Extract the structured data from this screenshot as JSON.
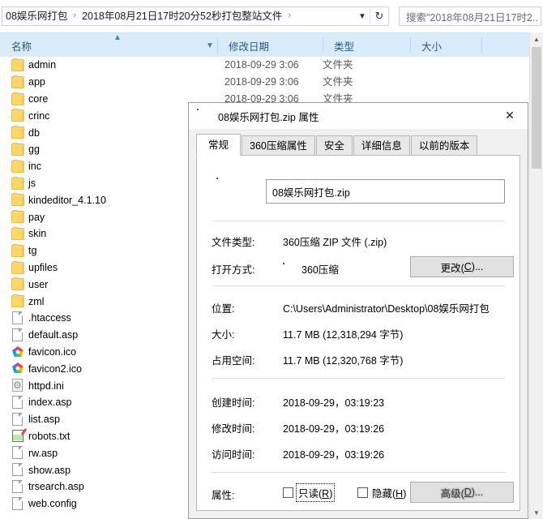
{
  "explorer": {
    "address": {
      "crumbs": [
        "08娱乐网打包",
        "2018年08月21日17时20分52秒打包整站文件"
      ],
      "separator": "›",
      "dropdown_icon": "chevron-down-icon",
      "refresh_icon": "refresh-icon"
    },
    "search": {
      "placeholder": "搜索\"2018年08月21日17时2..",
      "icon": "search-icon"
    },
    "columns": [
      {
        "label": "名称",
        "sorted": true,
        "sort_dir": "asc"
      },
      {
        "label": "修改日期"
      },
      {
        "label": "类型"
      },
      {
        "label": "大小"
      }
    ],
    "rows": [
      {
        "name": "admin",
        "date": "2018-09-29 3:06",
        "type": "文件夹",
        "size": "",
        "icon": "folder-icon"
      },
      {
        "name": "app",
        "date": "2018-09-29 3:06",
        "type": "文件夹",
        "size": "",
        "icon": "folder-icon"
      },
      {
        "name": "core",
        "date": "2018-09-29 3:06",
        "type": "文件夹",
        "size": "",
        "icon": "folder-icon"
      },
      {
        "name": "crinc",
        "date": "",
        "type": "",
        "size": "",
        "icon": "folder-icon"
      },
      {
        "name": "db",
        "date": "",
        "type": "",
        "size": "",
        "icon": "folder-icon"
      },
      {
        "name": "gg",
        "date": "",
        "type": "",
        "size": "",
        "icon": "folder-icon"
      },
      {
        "name": "inc",
        "date": "",
        "type": "",
        "size": "",
        "icon": "folder-icon"
      },
      {
        "name": "js",
        "date": "",
        "type": "",
        "size": "",
        "icon": "folder-icon"
      },
      {
        "name": "kindeditor_4.1.10",
        "date": "",
        "type": "",
        "size": "",
        "icon": "folder-icon"
      },
      {
        "name": "pay",
        "date": "",
        "type": "",
        "size": "",
        "icon": "folder-icon"
      },
      {
        "name": "skin",
        "date": "",
        "type": "",
        "size": "",
        "icon": "folder-icon"
      },
      {
        "name": "tg",
        "date": "",
        "type": "",
        "size": "",
        "icon": "folder-icon"
      },
      {
        "name": "upfiles",
        "date": "",
        "type": "",
        "size": "",
        "icon": "folder-icon"
      },
      {
        "name": "user",
        "date": "",
        "type": "",
        "size": "",
        "icon": "folder-icon"
      },
      {
        "name": "zml",
        "date": "",
        "type": "",
        "size": "",
        "icon": "folder-icon"
      },
      {
        "name": ".htaccess",
        "date": "",
        "type": "",
        "size": "",
        "icon": "document-icon"
      },
      {
        "name": "default.asp",
        "date": "",
        "type": "",
        "size": "",
        "icon": "document-icon"
      },
      {
        "name": "favicon.ico",
        "date": "",
        "type": "",
        "size": "",
        "icon": "favicon-icon"
      },
      {
        "name": "favicon2.ico",
        "date": "",
        "type": "",
        "size": "",
        "icon": "favicon-icon"
      },
      {
        "name": "httpd.ini",
        "date": "",
        "type": "",
        "size": "",
        "icon": "settings-file-icon"
      },
      {
        "name": "index.asp",
        "date": "",
        "type": "",
        "size": "",
        "icon": "document-icon"
      },
      {
        "name": "list.asp",
        "date": "",
        "type": "",
        "size": "",
        "icon": "document-icon"
      },
      {
        "name": "robots.txt",
        "date": "",
        "type": "",
        "size": "",
        "icon": "notepad-icon"
      },
      {
        "name": "rw.asp",
        "date": "",
        "type": "",
        "size": "",
        "icon": "document-icon"
      },
      {
        "name": "show.asp",
        "date": "",
        "type": "",
        "size": "",
        "icon": "document-icon"
      },
      {
        "name": "trsearch.asp",
        "date": "",
        "type": "",
        "size": "",
        "icon": "document-icon"
      },
      {
        "name": "web.config",
        "date": "",
        "type": "",
        "size": "",
        "icon": "document-icon"
      }
    ]
  },
  "dialog": {
    "title": "08娱乐网打包.zip 属性",
    "title_icon": "zip-file-icon",
    "close_label": "✕",
    "tabs": [
      {
        "label": "常规",
        "active": true
      },
      {
        "label": "360压缩属性",
        "active": false
      },
      {
        "label": "安全",
        "active": false
      },
      {
        "label": "详细信息",
        "active": false
      },
      {
        "label": "以前的版本",
        "active": false
      }
    ],
    "filename": "08娱乐网打包.zip",
    "fields": [
      {
        "key": "文件类型:",
        "value": "360压缩 ZIP 文件 (.zip)"
      },
      {
        "key": "打开方式:",
        "value": "360压缩",
        "has_icon": true
      },
      {
        "key": "位置:",
        "value": "C:\\Users\\Administrator\\Desktop\\08娱乐网打包"
      },
      {
        "key": "大小:",
        "value": "11.7 MB (12,318,294 字节)"
      },
      {
        "key": "占用空间:",
        "value": "11.7 MB (12,320,768 字节)"
      },
      {
        "key": "创建时间:",
        "value": "2018-09-29，03:19:23"
      },
      {
        "key": "修改时间:",
        "value": "2018-09-29，03:19:26"
      },
      {
        "key": "访问时间:",
        "value": "2018-09-29，03:19:26"
      }
    ],
    "change_button": {
      "text": "更改(",
      "accel": "C",
      "tail": ")..."
    },
    "attributes_label": "属性:",
    "readonly": {
      "text": "只读(",
      "accel": "R",
      "tail": ")",
      "checked": false
    },
    "hidden": {
      "text": "隐藏(",
      "accel": "H",
      "tail": ")",
      "checked": false
    },
    "advanced_button": {
      "text": "高级(",
      "accel": "D",
      "tail": ")..."
    }
  }
}
